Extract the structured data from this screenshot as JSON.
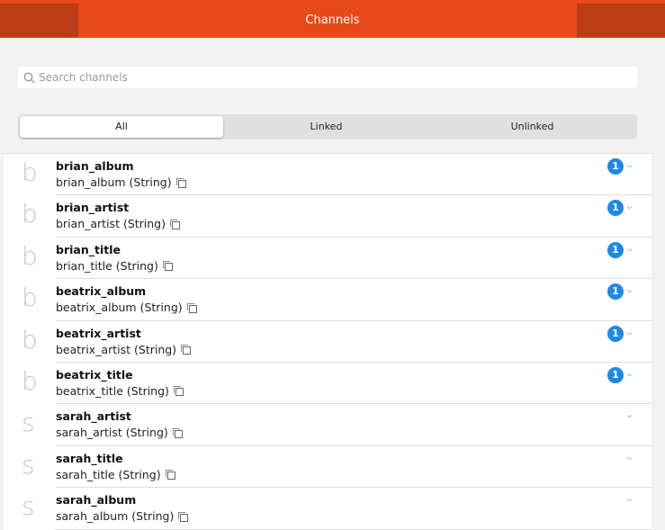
{
  "header": {
    "title": "Channels"
  },
  "search": {
    "placeholder": "Search channels"
  },
  "tabs": [
    {
      "label": "All"
    },
    {
      "label": "Linked"
    },
    {
      "label": "Unlinked"
    }
  ],
  "channels": [
    {
      "avatar": "b",
      "name": "brian_album",
      "sub": "brian_album (String)",
      "badge": "1"
    },
    {
      "avatar": "b",
      "name": "brian_artist",
      "sub": "brian_artist (String)",
      "badge": "1"
    },
    {
      "avatar": "b",
      "name": "brian_title",
      "sub": "brian_title (String)",
      "badge": "1"
    },
    {
      "avatar": "b",
      "name": "beatrix_album",
      "sub": "beatrix_album (String)",
      "badge": "1"
    },
    {
      "avatar": "b",
      "name": "beatrix_artist",
      "sub": "beatrix_artist (String)",
      "badge": "1"
    },
    {
      "avatar": "b",
      "name": "beatrix_title",
      "sub": "beatrix_title (String)",
      "badge": "1"
    },
    {
      "avatar": "s",
      "name": "sarah_artist",
      "sub": "sarah_artist (String)",
      "badge": null
    },
    {
      "avatar": "s",
      "name": "sarah_title",
      "sub": "sarah_title (String)",
      "badge": null
    },
    {
      "avatar": "s",
      "name": "sarah_album",
      "sub": "sarah_album (String)",
      "badge": null
    }
  ]
}
